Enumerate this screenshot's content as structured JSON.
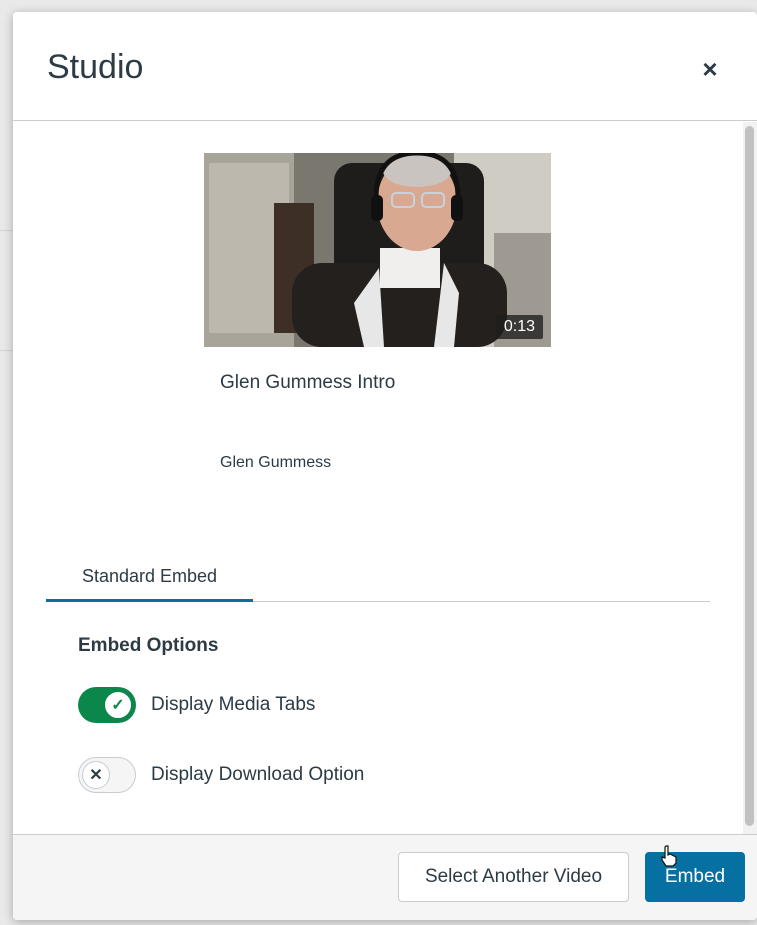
{
  "modal": {
    "title": "Studio",
    "close_icon": "close-icon"
  },
  "video": {
    "duration": "0:13",
    "title": "Glen Gummess Intro",
    "author": "Glen Gummess"
  },
  "tabs": [
    {
      "label": "Standard Embed",
      "selected": true
    }
  ],
  "embed_options": {
    "heading": "Embed Options",
    "toggles": [
      {
        "label": "Display Media Tabs",
        "checked": true
      },
      {
        "label": "Display Download Option",
        "checked": false
      }
    ]
  },
  "footer": {
    "secondary_label": "Select Another Video",
    "primary_label": "Embed"
  },
  "colors": {
    "primary": "#0770a3",
    "toggle_on": "#0b874b",
    "text": "#2d3b45",
    "border": "#c7cdd1"
  }
}
